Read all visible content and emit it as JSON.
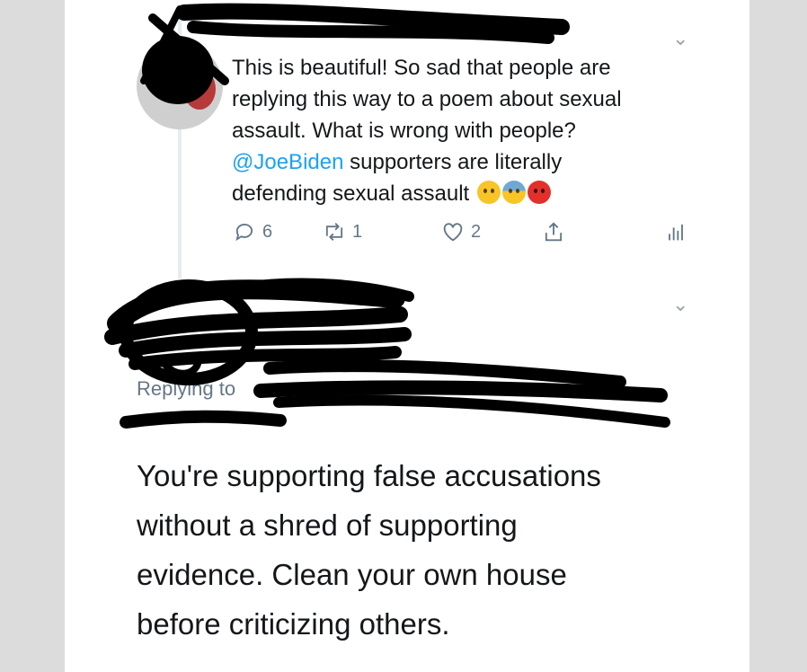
{
  "tweet1": {
    "lines": [
      "This is beautiful! So sad that people are",
      "replying this way to a poem about sexual",
      "assault. What is wrong with people?"
    ],
    "mention": "@JoeBiden",
    "line4_rest": " supporters are literally",
    "line5": "defending sexual assault ",
    "emojis": [
      "surprised-face",
      "anxious-face",
      "pouting-face"
    ],
    "reply_count": "6",
    "retweet_count": "1",
    "like_count": "2"
  },
  "tweet2": {
    "replying_to": "Replying to",
    "lines": [
      "You're supporting false accusations",
      "without a shred of supporting",
      "evidence. Clean your own house",
      "before criticizing others."
    ]
  },
  "colors": {
    "accent": "#1da1f2",
    "text": "#14171a",
    "muted": "#657786"
  }
}
